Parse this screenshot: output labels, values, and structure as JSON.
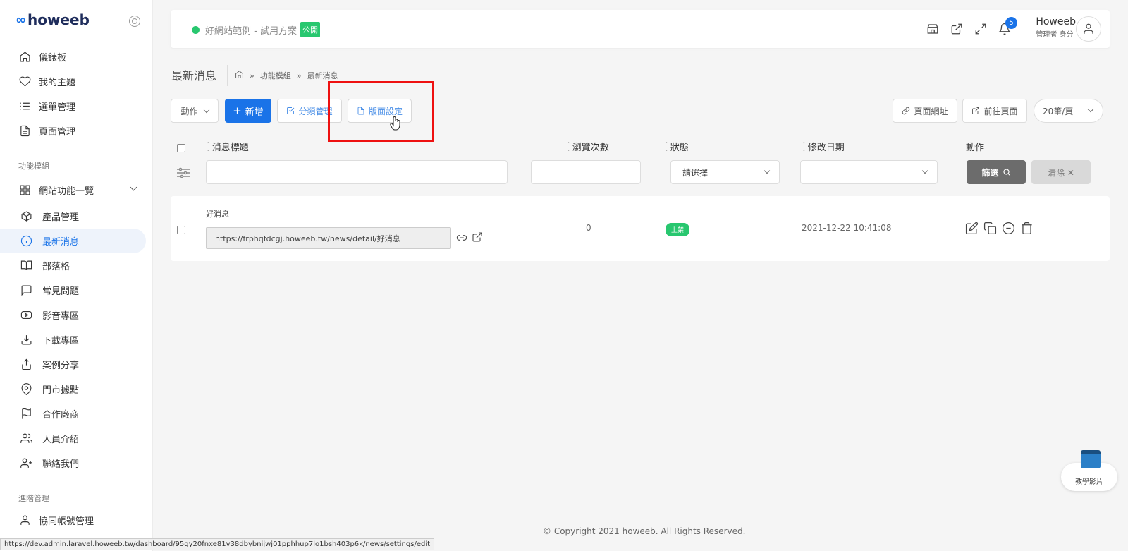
{
  "brand": {
    "mark": "∞",
    "name": "howeeb"
  },
  "sidebar": {
    "main_items": [
      {
        "label": "儀錶板",
        "icon": "home-icon"
      },
      {
        "label": "我的主題",
        "icon": "heart-icon"
      },
      {
        "label": "選單管理",
        "icon": "list-icon"
      },
      {
        "label": "頁面管理",
        "icon": "file-text-icon"
      }
    ],
    "section_modules": "功能模組",
    "site_features": "網站功能一覽",
    "module_items": [
      {
        "label": "產品管理",
        "icon": "box-icon"
      },
      {
        "label": "最新消息",
        "icon": "info-icon",
        "active": true
      },
      {
        "label": "部落格",
        "icon": "book-open-icon"
      },
      {
        "label": "常見問題",
        "icon": "message-square-icon"
      },
      {
        "label": "影音專區",
        "icon": "youtube-icon"
      },
      {
        "label": "下載專區",
        "icon": "download-icon"
      },
      {
        "label": "案例分享",
        "icon": "share-icon"
      },
      {
        "label": "門市據點",
        "icon": "map-pin-icon"
      },
      {
        "label": "合作廠商",
        "icon": "flag-icon"
      },
      {
        "label": "人員介紹",
        "icon": "users-icon"
      },
      {
        "label": "聯絡我們",
        "icon": "user-plus-icon"
      }
    ],
    "section_advanced": "進階管理",
    "advanced_items": [
      {
        "label": "協同帳號管理",
        "icon": "user-icon"
      }
    ]
  },
  "topbar": {
    "site_name": "好網站範例 - 試用方案",
    "public_badge": "公開",
    "notification_count": "5",
    "user_name": "Howeeb",
    "user_role": "管理者 身分"
  },
  "page": {
    "title": "最新消息",
    "breadcrumb": [
      "功能模組",
      "最新消息"
    ],
    "breadcrumb_sep": "»"
  },
  "toolbar": {
    "action_label": "動作",
    "add_label": "新增",
    "category_label": "分類管理",
    "layout_label": "版面設定",
    "page_url_label": "頁面網址",
    "goto_page_label": "前往頁面",
    "per_page_label": "20筆/頁"
  },
  "table": {
    "headers": {
      "title": "消息標題",
      "views": "瀏覽次數",
      "status": "狀態",
      "modified": "修改日期",
      "actions": "動作"
    },
    "filters": {
      "status_placeholder": "請選擇",
      "filter_button": "篩選",
      "clear_button": "清除 ✕"
    },
    "rows": [
      {
        "title": "好消息",
        "url": "https://frphqfdcgj.howeeb.tw/news/detail/好消息",
        "views": "0",
        "status": "上架",
        "modified": "2021-12-22 10:41:08"
      }
    ]
  },
  "footer": {
    "copyright": "© Copyright 2021 howeeb. All Rights Reserved."
  },
  "status_bar_url": "https://dev.admin.laravel.howeeb.tw/dashboard/95gy20fnxe81v38dbybnijwj01pphhup7lo1bsh403p6k/news/settings/edit",
  "tutorial_widget": {
    "label": "教學影片"
  },
  "colors": {
    "primary": "#1a73e8",
    "success": "#28c76f",
    "highlight": "#e11111"
  }
}
